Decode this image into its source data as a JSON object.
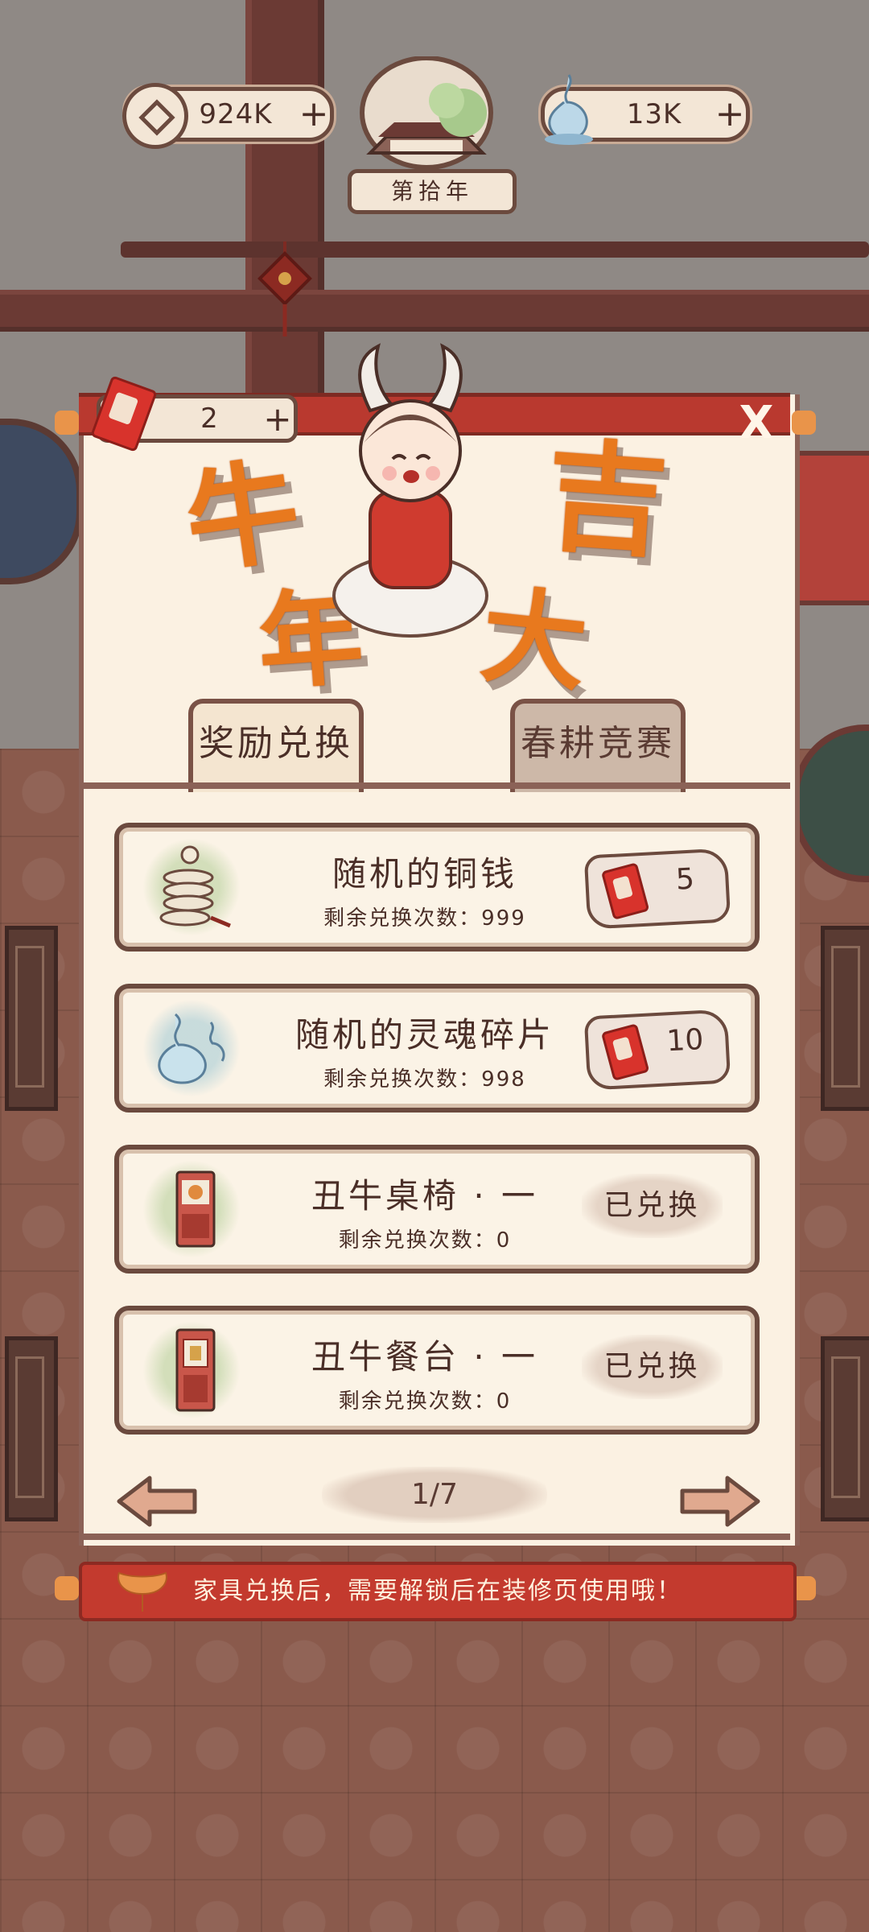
{
  "header": {
    "coins": "924K",
    "souls": "13K",
    "plus": "+",
    "year": "第拾年"
  },
  "event": {
    "title_chars": [
      "牛",
      "年",
      "大",
      "吉"
    ],
    "tickets": "2",
    "close": "X",
    "tabs": [
      {
        "label": "奖励兑换",
        "active": true
      },
      {
        "label": "春耕竞赛",
        "active": false
      }
    ]
  },
  "items": [
    {
      "title": "随机的铜钱",
      "remain": "剩余兑换次数：999",
      "cost": "5",
      "icon": "coin-string-icon",
      "exchanged": false
    },
    {
      "title": "随机的灵魂碎片",
      "remain": "剩余兑换次数：998",
      "cost": "10",
      "icon": "soul-fragment-icon",
      "exchanged": false
    },
    {
      "title": "丑牛桌椅 · 一",
      "remain": "剩余兑换次数：0",
      "status": "已兑换",
      "icon": "table-chair-icon",
      "exchanged": true
    },
    {
      "title": "丑牛餐台 · 一",
      "remain": "剩余兑换次数：0",
      "status": "已兑换",
      "icon": "dining-table-icon",
      "exchanged": true
    }
  ],
  "pager": {
    "page": "1/7"
  },
  "notice": "家具兑换后，需要解锁后在装修页使用哦！",
  "colors": {
    "accent_red": "#c33a2e",
    "panel": "#fbf1e2",
    "frame": "#6b4a3e",
    "banner_orange": "#e8791e"
  }
}
